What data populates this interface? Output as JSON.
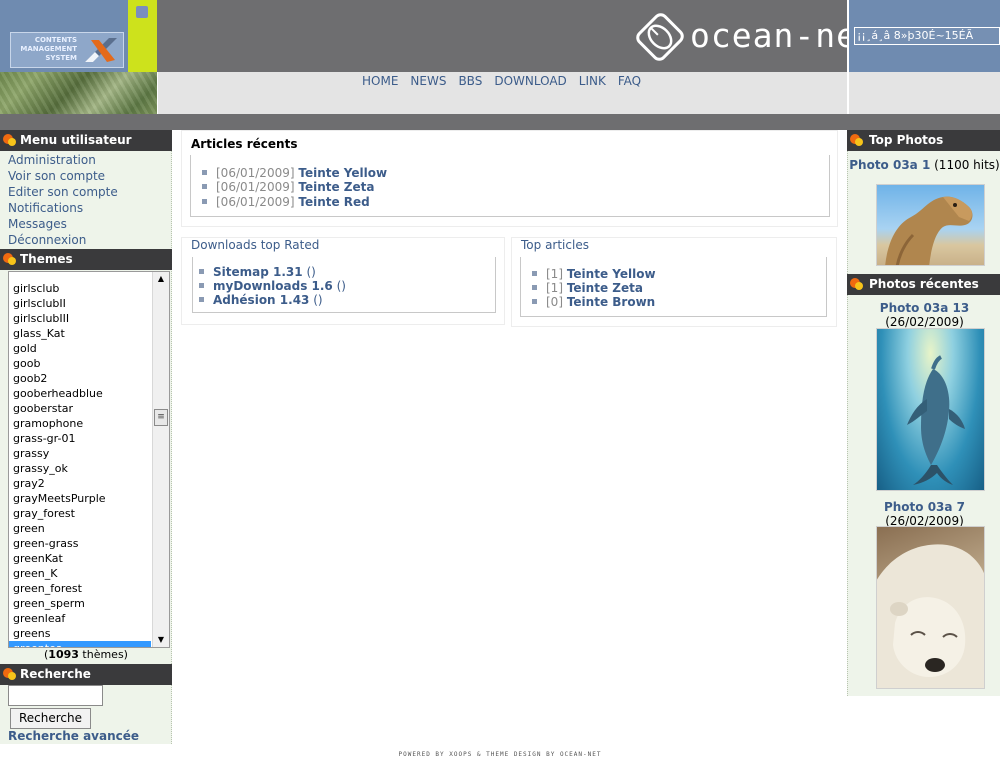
{
  "header": {
    "cms_logo_text": "CONTENTS\nMANAGEMENT\nSYSTEM",
    "brand": "ocean-net",
    "search_value": "¡¡¸á¸â 8»þ30É~15ÉÃ"
  },
  "nav": {
    "items": [
      "HOME",
      "NEWS",
      "BBS",
      "DOWNLOAD",
      "LINK",
      "FAQ"
    ]
  },
  "user_menu": {
    "title": "Menu utilisateur",
    "items": [
      "Administration",
      "Voir son compte",
      "Editer son compte",
      "Notifications",
      "Messages",
      "Déconnexion"
    ]
  },
  "themes": {
    "title": "Themes",
    "list": [
      "girlsclub",
      "girlsclubII",
      "girlsclubIII",
      "glass_Kat",
      "gold",
      "goob",
      "goob2",
      "gooberheadblue",
      "gooberstar",
      "gramophone",
      "grass-gr-01",
      "grassy",
      "grassy_ok",
      "gray2",
      "grayMeetsPurple",
      "gray_forest",
      "green",
      "green-grass",
      "greenKat",
      "green_K",
      "green_forest",
      "green_sperm",
      "greenleaf",
      "greens",
      "greentea"
    ],
    "selected": "greentea",
    "count": "1093",
    "count_suffix": " thèmes)",
    "count_prefix": "("
  },
  "search": {
    "title": "Recherche",
    "button": "Recherche",
    "advanced": "Recherche avancée"
  },
  "recent_articles": {
    "title": "Articles récents",
    "items": [
      {
        "date": "[06/01/2009]",
        "title": "Teinte Yellow"
      },
      {
        "date": "[06/01/2009]",
        "title": "Teinte Zeta"
      },
      {
        "date": "[06/01/2009]",
        "title": "Teinte Red"
      }
    ]
  },
  "downloads": {
    "title": "Downloads top Rated",
    "items": [
      {
        "title": "Sitemap 1.31",
        "meta": "()"
      },
      {
        "title": "myDownloads 1.6",
        "meta": "()"
      },
      {
        "title": "Adhésion 1.43",
        "meta": "()"
      }
    ]
  },
  "top_articles": {
    "title": "Top articles",
    "items": [
      {
        "count": "[1]",
        "title": "Teinte Yellow"
      },
      {
        "count": "[1]",
        "title": "Teinte Zeta"
      },
      {
        "count": "[0]",
        "title": "Teinte Brown"
      }
    ]
  },
  "top_photos": {
    "title": "Top Photos",
    "items": [
      {
        "title": "Photo 03a 1",
        "meta": " (1100 hits)"
      }
    ]
  },
  "recent_photos": {
    "title": "Photos récentes",
    "items": [
      {
        "title": "Photo 03a 13",
        "meta": " (26/02/2009)"
      },
      {
        "title": "Photo 03a 7",
        "meta": " (26/02/2009)"
      }
    ]
  },
  "footer": "POWERED BY XOOPS & THEME DESIGN BY OCEAN-NET",
  "colors": {
    "accent_link": "#3c5c8a",
    "header_dark": "#6e6e70",
    "header_blue": "#6f8bb0",
    "lime": "#cde21c",
    "block_title": "#3a3a3c",
    "column_bg": "#eef4ea"
  }
}
